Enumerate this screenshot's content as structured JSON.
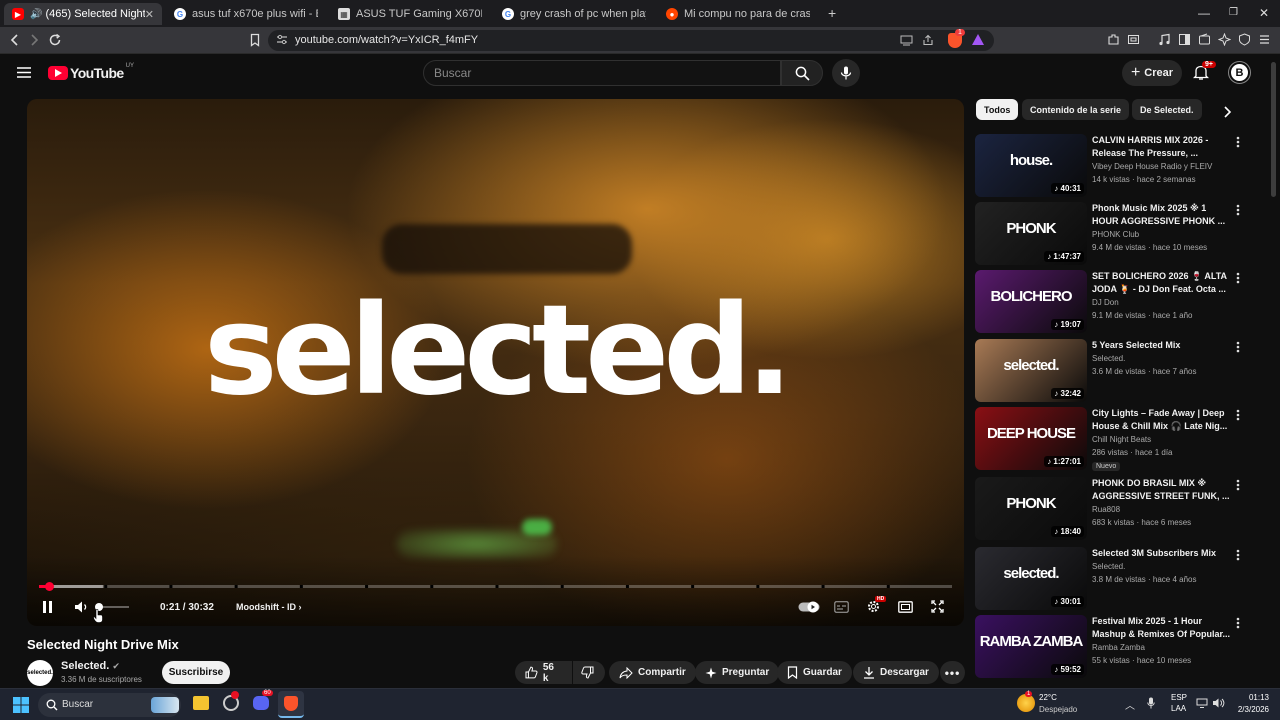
{
  "browser": {
    "tabs": [
      {
        "label": "(465) Selected Night Drive M",
        "active": true,
        "favicon": "youtube-icon"
      },
      {
        "label": "asus tuf x670e plus wifi - Buscar con",
        "favicon": "google-icon"
      },
      {
        "label": "ASUS TUF Gaming X670E-PLUS WIFI",
        "favicon": "asus-icon"
      },
      {
        "label": "grey crash of pc when playing and re",
        "favicon": "google-icon"
      },
      {
        "label": "Mi compu no para de crashearse : r/",
        "favicon": "reddit-icon"
      }
    ],
    "new_tab": "+",
    "url": "youtube.com/watch?v=YxICR_f4mFY",
    "shield_badge": "1"
  },
  "youtube": {
    "logo_text": "YouTube",
    "region": "UY",
    "search_placeholder": "Buscar",
    "create_label": "Crear",
    "notifications": "9+",
    "avatar": "B"
  },
  "player": {
    "overlay_logo": "selected.",
    "time": "0:21 / 30:32",
    "chapter": "Moodshift - ID",
    "progress_fraction": 0.0115,
    "buffer_fraction": 0.07,
    "volume_fraction": 0.0
  },
  "video": {
    "title": "Selected Night Drive Mix",
    "channel": "Selected.",
    "channel_avatar_text": "selected.",
    "subscribers": "3.36 M de suscriptores",
    "subscribe_label": "Suscribirse",
    "likes": "56 k",
    "share_label": "Compartir",
    "ask_label": "Preguntar",
    "save_label": "Guardar",
    "download_label": "Descargar"
  },
  "chips": [
    "Todos",
    "Contenido de la serie",
    "De Selected."
  ],
  "recommendations": [
    {
      "title": "CALVIN HARRIS MIX 2026 - Release The Pressure, ...",
      "channel": "Vibey Deep House Radio y FLEIV",
      "meta": "14 k vistas · hace 2 semanas",
      "duration": "40:31",
      "thumb_text": "house.",
      "thumb_color": "#1b2440"
    },
    {
      "title": "Phonk Music Mix 2025 ※ 1 HOUR AGGRESSIVE PHONK ...",
      "channel": "PHONK Club",
      "meta": "9.4 M de vistas · hace 10 meses",
      "duration": "1:47:37",
      "thumb_text": "PHONK",
      "thumb_color": "#222222"
    },
    {
      "title": "SET BOLICHERO 2026 🍷 ALTA JODA 🍹 - DJ Don Feat. Octa ...",
      "channel": "DJ Don",
      "meta": "9.1 M de vistas · hace 1 año",
      "duration": "19:07",
      "thumb_text": "BOLICHERO",
      "thumb_color": "#5a1a6e"
    },
    {
      "title": "5 Years Selected Mix",
      "channel": "Selected.",
      "meta": "3.6 M de vistas · hace 7 años",
      "duration": "32:42",
      "thumb_text": "selected.",
      "thumb_color": "#a87a55"
    },
    {
      "title": "City Lights – Fade Away | Deep House & Chill Mix 🎧 Late Nig...",
      "channel": "Chill Night Beats",
      "meta": "286 vistas · hace 1 día",
      "badge": "Nuevo",
      "duration": "1:27:01",
      "thumb_text": "DEEP HOUSE",
      "thumb_color": "#8a0f14"
    },
    {
      "title": "PHONK DO BRASIL MIX ※ AGGRESSIVE STREET FUNK, ...",
      "channel": "Rua808",
      "meta": "683 k vistas · hace 6 meses",
      "duration": "18:40",
      "thumb_text": "PHONK",
      "thumb_color": "#1a1a1a"
    },
    {
      "title": "Selected 3M Subscribers Mix",
      "channel": "Selected.",
      "meta": "3.8 M de vistas · hace 4 años",
      "duration": "30:01",
      "thumb_text": "selected.",
      "thumb_color": "#2a2a30"
    },
    {
      "title": "Festival Mix 2025 - 1 Hour Mashup & Remixes Of Popular...",
      "channel": "Ramba Zamba",
      "meta": "55 k vistas · hace 10 meses",
      "duration": "59:52",
      "thumb_text": "RAMBA ZAMBA",
      "thumb_color": "#3a1060"
    }
  ],
  "taskbar": {
    "search_placeholder": "Buscar",
    "weather_temp": "22°C",
    "weather_desc": "Despejado",
    "lang": "ESP",
    "lang2": "LAA",
    "time": "01:13",
    "date": "2/3/2026",
    "weather_badge": "1",
    "discord_badge": "60"
  },
  "colors": {
    "accent": "#ff0033",
    "bg": "#0f0f0f"
  }
}
